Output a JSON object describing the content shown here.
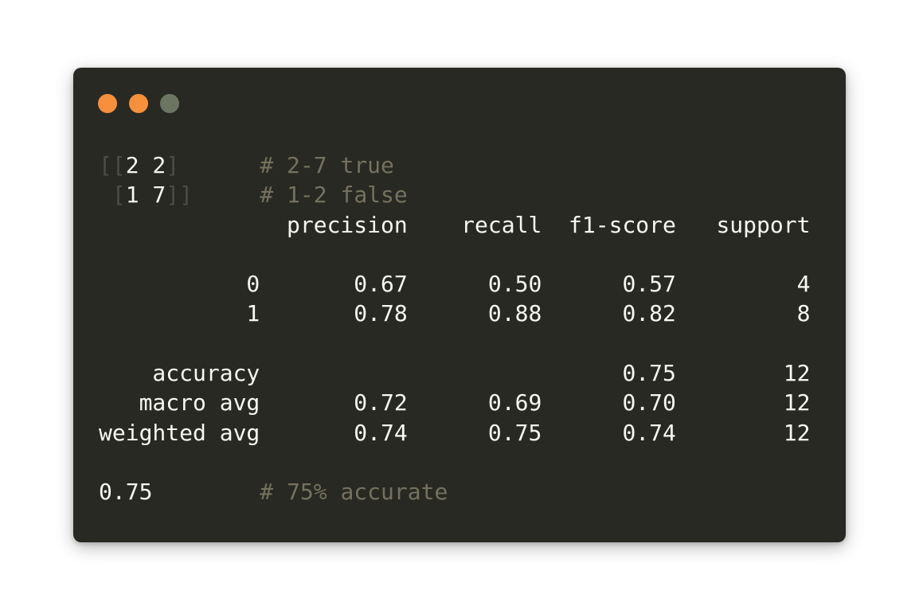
{
  "window": {
    "controls": [
      {
        "name": "close",
        "color": "#f6903d"
      },
      {
        "name": "minimize",
        "color": "#f6903d"
      },
      {
        "name": "zoom",
        "color": "#6b7562"
      }
    ]
  },
  "terminal": {
    "matrix": {
      "row1": {
        "open": "[[",
        "values": "2 2",
        "close": "]",
        "gap": "      ",
        "comment": "# 2-7 true"
      },
      "row2": {
        "lead": " ",
        "open": "[",
        "values": "1 7",
        "close": "]]",
        "gap": "     ",
        "comment": "# 1-2 false"
      }
    },
    "report": {
      "header": "              precision    recall  f1-score   support",
      "rows": [
        "",
        "           0       0.67      0.50      0.57         4",
        "           1       0.78      0.88      0.82         8",
        "",
        "    accuracy                           0.75        12",
        "   macro avg       0.72      0.69      0.70        12",
        "weighted avg       0.74      0.75      0.74        12",
        ""
      ]
    },
    "score": {
      "value": "0.75",
      "gap": "        ",
      "comment": "# 75% accurate"
    }
  }
}
